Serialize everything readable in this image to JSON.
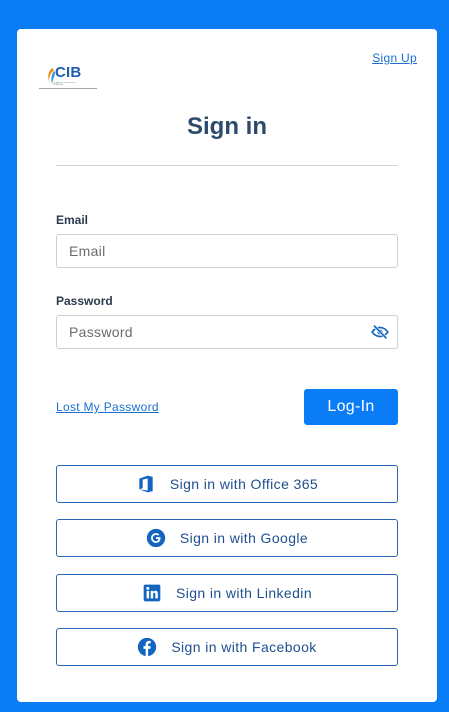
{
  "header": {
    "signup_label": "Sign Up",
    "logo_text": "CIB",
    "logo_subtext": "CREATIVE INNOVATIVE BUSINESS"
  },
  "title": "Sign in",
  "form": {
    "email_label": "Email",
    "email_placeholder": "Email",
    "email_value": "",
    "password_label": "Password",
    "password_placeholder": "Password",
    "password_value": "",
    "lost_password_label": "Lost My Password",
    "login_label": "Log-In"
  },
  "social": [
    {
      "label": "Sign in with Office 365",
      "icon": "office365-icon"
    },
    {
      "label": "Sign in with Google",
      "icon": "google-icon"
    },
    {
      "label": "Sign in with Linkedin",
      "icon": "linkedin-icon"
    },
    {
      "label": "Sign in with Facebook",
      "icon": "facebook-icon"
    }
  ],
  "colors": {
    "background": "#0a7cf5",
    "primary": "#0a7cf5",
    "title": "#2e4a6a",
    "link": "#1b6fd1",
    "social_border": "#2a66b8",
    "social_icon": "#1565c0"
  }
}
